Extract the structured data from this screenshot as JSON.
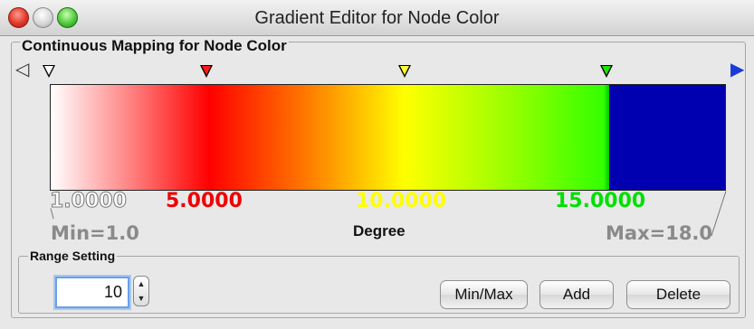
{
  "window": {
    "title": "Gradient Editor for Node Color"
  },
  "mapping": {
    "group_label": "Continuous Mapping for Node Color",
    "values": [
      "1.0000",
      "5.0000",
      "10.0000",
      "15.0000"
    ],
    "attribute": "Degree",
    "min_label": "Min=1.0",
    "max_label": "Max=18.0",
    "colors": {
      "start": "#ffffff",
      "red": "#ff0000",
      "yellow": "#ffff00",
      "green": "#00c800",
      "above": "#0000b0"
    }
  },
  "range": {
    "group_label": "Range Setting",
    "spinner_value": "10"
  },
  "buttons": {
    "minmax": "Min/Max",
    "add": "Add",
    "delete": "Delete"
  }
}
